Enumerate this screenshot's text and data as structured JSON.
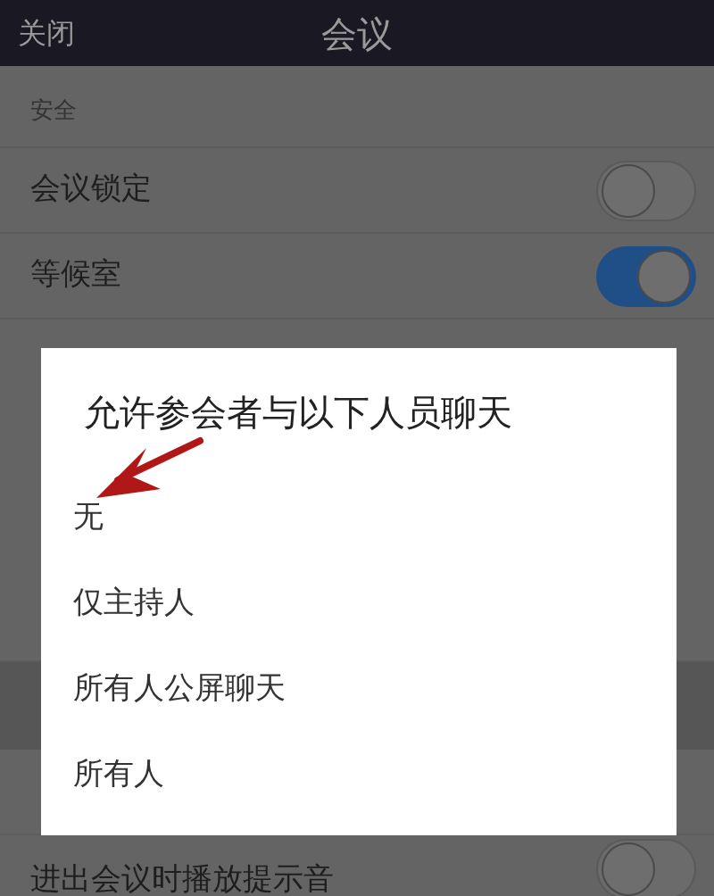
{
  "header": {
    "close": "关闭",
    "title": "会议"
  },
  "section": "安全",
  "settings": [
    {
      "label": "会议锁定",
      "on": false
    },
    {
      "label": "等候室",
      "on": true
    }
  ],
  "bottom_row": {
    "label": "进出会议时播放提示音",
    "on": false
  },
  "dialog": {
    "title": "允许参会者与以下人员聊天",
    "options": [
      "无",
      "仅主持人",
      "所有人公屏聊天",
      "所有人"
    ]
  }
}
